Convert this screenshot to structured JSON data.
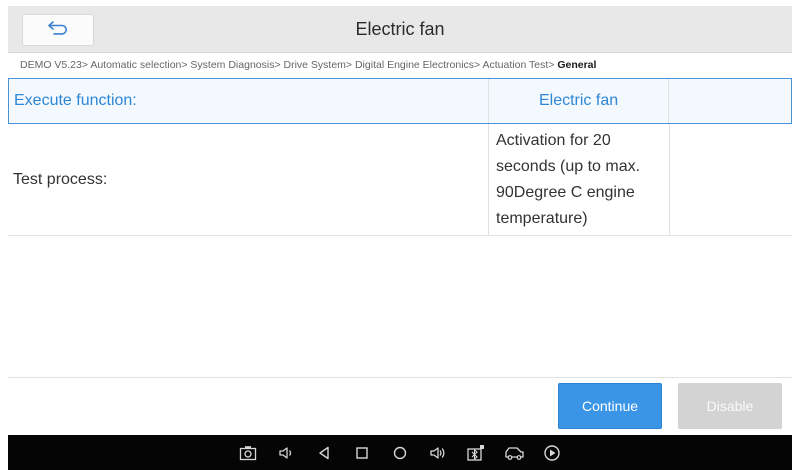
{
  "window": {
    "title": "Electric fan"
  },
  "breadcrumb": {
    "path": "DEMO V5.23> Automatic selection> System Diagnosis> Drive System> Digital Engine Electronics> Actuation Test> ",
    "current": "General"
  },
  "table": {
    "header": {
      "label": "Execute function:",
      "value": "Electric fan",
      "extra": ""
    },
    "rows": [
      {
        "label": "Test process:",
        "value": "Activation for 20 seconds (up to max. 90Degree C engine temperature)",
        "extra": ""
      }
    ]
  },
  "footer": {
    "continue_label": "Continue",
    "disable_label": "Disable"
  },
  "navbar": {
    "icons": [
      "screenshot-icon",
      "volume-down-icon",
      "back-triangle-icon",
      "recent-apps-icon",
      "home-circle-icon",
      "volume-up-icon",
      "vci-connection-icon",
      "vehicle-icon",
      "play-icon"
    ]
  },
  "colors": {
    "accent": "#2f86d6",
    "header_border": "#4a92d6",
    "continue_bg": "#3a95e6",
    "disable_bg": "#d3d3d3",
    "titlebar_bg": "#e8e8e8",
    "navbar_bg": "#050505"
  }
}
